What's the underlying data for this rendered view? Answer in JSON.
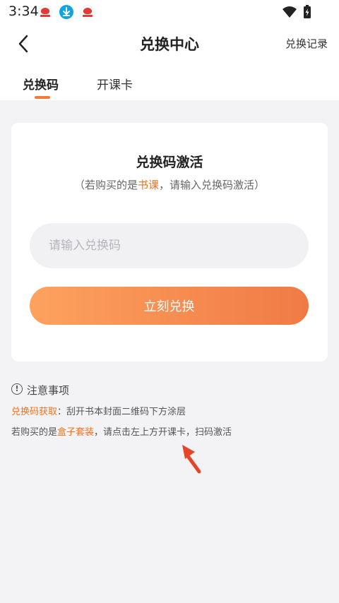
{
  "status_bar": {
    "time": "3:34",
    "notification_icons": [
      "app-notification-icon",
      "download-icon",
      "app-notification-icon"
    ],
    "system_icons": [
      "wifi-icon",
      "battery-icon"
    ]
  },
  "header": {
    "back_icon": "chevron-left-icon",
    "title": "兑换中心",
    "record_link": "兑换记录"
  },
  "tabs": [
    {
      "label": "兑换码",
      "active": true
    },
    {
      "label": "开课卡",
      "active": false
    }
  ],
  "card": {
    "title": "兑换码激活",
    "subtitle_prefix": "（若购买的是",
    "subtitle_highlight": "书课",
    "subtitle_suffix": "，请输入兑换码激活）",
    "input_value": "",
    "input_placeholder": "请输入兑换码",
    "button_label": "立刻兑换"
  },
  "notice": {
    "icon": "info-circle-icon",
    "title": "注意事项",
    "line1_highlight": "兑换码获取",
    "line1_text": "：刮开书本封面二维码下方涂层",
    "line2_prefix": "若购买的是",
    "line2_highlight": "盒子套装",
    "line2_suffix": "，请点击左上方开课卡，扫码激活"
  },
  "colors": {
    "accent": "#f2721f",
    "button_gradient_start": "#fda25f",
    "button_gradient_end": "#f07a45",
    "page_background": "#f3f3f5",
    "arrow_annotation": "#e8442a"
  }
}
